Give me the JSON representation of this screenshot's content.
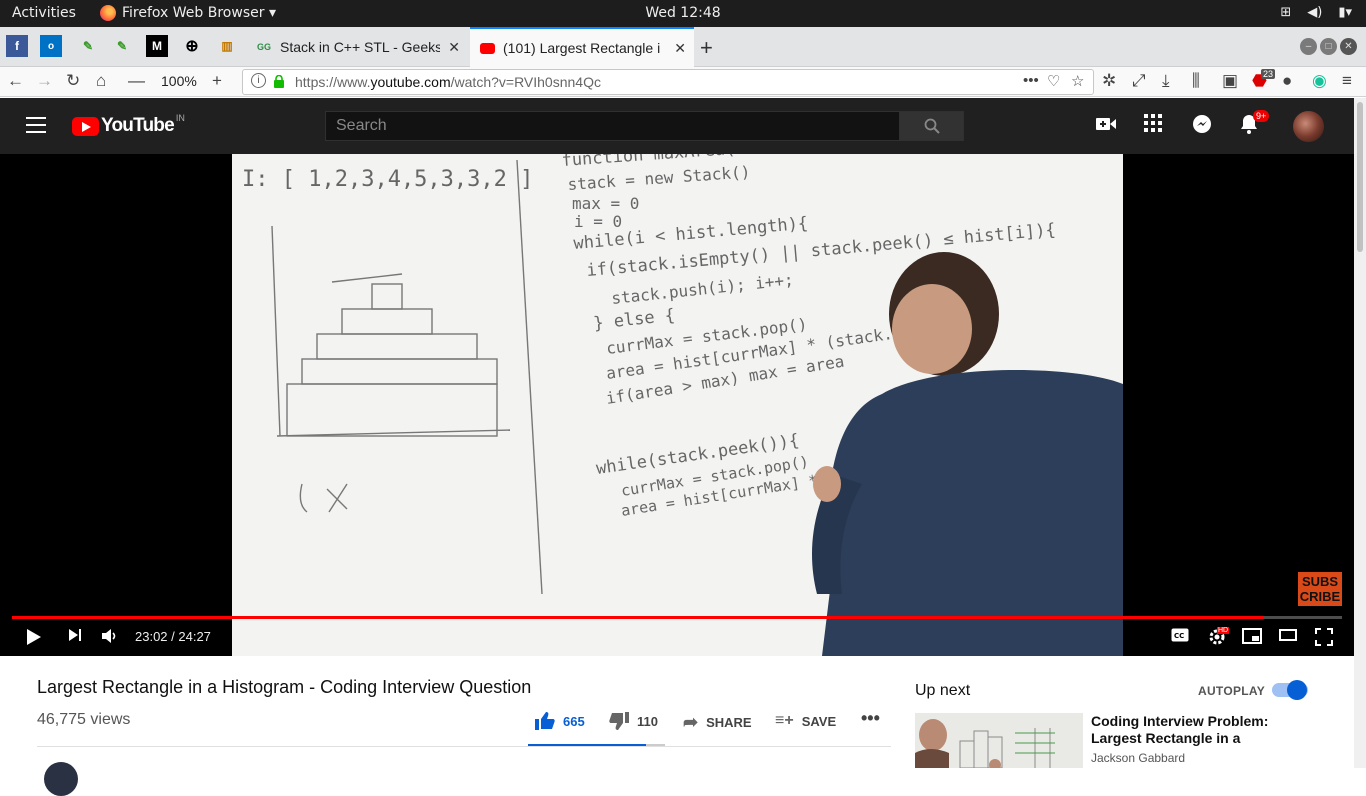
{
  "system_bar": {
    "activities": "Activities",
    "app_name": "Firefox Web Browser ▾",
    "clock": "Wed 12:48"
  },
  "browser": {
    "tabs": [
      {
        "title": "Stack in C++ STL - Geeksf",
        "favicon": "geeksforgeeks-icon"
      },
      {
        "title": "(101) Largest Rectangle i",
        "favicon": "youtube-icon",
        "active": true
      }
    ],
    "zoom": "100%",
    "url_prefix": "https://www.",
    "url_domain": "youtube.com",
    "url_path": "/watch?v=RVIh0snn4Qc",
    "addon_badge": "23"
  },
  "youtube": {
    "logo_text": "YouTube",
    "logo_region": "IN",
    "search_placeholder": "Search",
    "notification_count": "9+"
  },
  "player": {
    "time": "23:02 / 24:27",
    "progress_fraction": 0.9417,
    "subscribe_badge": "SUBS\nCRIBE",
    "hd_badge": "HD"
  },
  "video": {
    "title": "Largest Rectangle in a Histogram - Coding Interview Question",
    "views": "46,775 views",
    "likes": "665",
    "dislikes": "110",
    "share_label": "SHARE",
    "save_label": "SAVE"
  },
  "sidebar": {
    "up_next": "Up next",
    "autoplay": "AUTOPLAY",
    "autoplay_on": true,
    "recommended": [
      {
        "title": "Coding Interview Problem: Largest Rectangle in a",
        "channel": "Jackson Gabbard"
      }
    ]
  },
  "colors": {
    "yt_red": "#ff0000",
    "yt_blue": "#065fd4",
    "firefox_accent": "#0a84ff"
  }
}
